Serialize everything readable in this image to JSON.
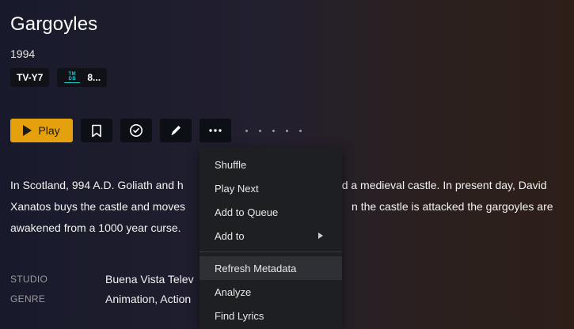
{
  "show": {
    "title": "Gargoyles",
    "year": "1994",
    "content_rating": "TV-Y7",
    "tmdb_logo_text": "TM\nDB",
    "tmdb_score": "8..."
  },
  "actions": {
    "play_label": "Play",
    "icons": [
      "play-icon",
      "bookmark-icon",
      "check-circle-icon",
      "pencil-icon",
      "more-icon"
    ]
  },
  "summary": "In Scotland, 994 A.D. Goliath and h… d a medieval castle. In present day, David Xanatos buys the castle and moves … n the castle is attacked the gargoyles are awakened from a 1000 year curse.",
  "summary_lines": [
    "In Scotland, 994 A.D. Goliath and h",
    "d a medieval castle. In present day, David",
    "Xanatos buys the castle and moves",
    "n the castle is attacked the gargoyles are",
    "awakened from a 1000 year curse."
  ],
  "metadata": [
    {
      "label": "STUDIO",
      "value": "Buena Vista Telev"
    },
    {
      "label": "GENRE",
      "value": "Animation, Action"
    }
  ],
  "context_menu": {
    "items": [
      "Shuffle",
      "Play Next",
      "Add to Queue",
      "Add to",
      "Refresh Metadata",
      "Analyze",
      "Find Lyrics"
    ]
  },
  "colors": {
    "accent": "#e5a00d",
    "tmdb": "#1fc6c8",
    "menu_bg": "#1e1f22",
    "menu_active": "#2e3035"
  }
}
